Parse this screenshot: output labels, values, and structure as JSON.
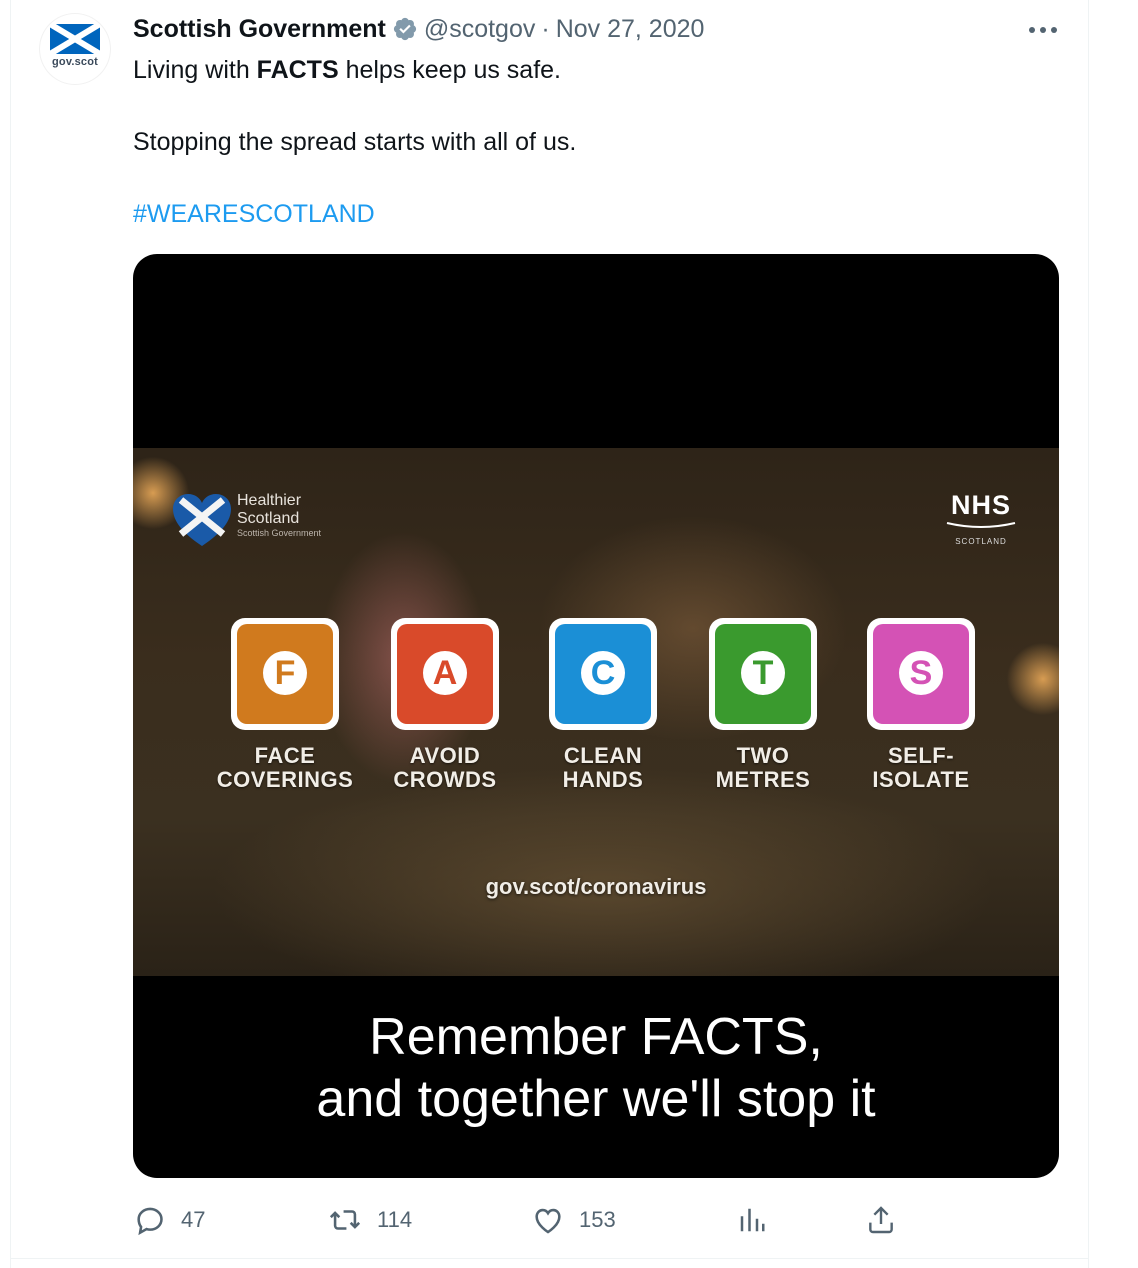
{
  "tweet": {
    "author": {
      "name": "Scottish Government",
      "handle": "@scotgov",
      "avatar_text": "gov.scot",
      "verified": true
    },
    "separator": "·",
    "date": "Nov 27, 2020",
    "text": {
      "line1_pre": "Living with ",
      "line1_bold": "FACTS",
      "line1_post": " helps keep us safe.",
      "line2": "Stopping the spread starts with all of us.",
      "hashtag": "#WEARESCOTLAND"
    },
    "media": {
      "logo_left": {
        "line1": "Healthier",
        "line2": "Scotland",
        "line3": "Scottish Government"
      },
      "logo_right": {
        "line1": "NHS",
        "line2": "SCOTLAND"
      },
      "facts": [
        {
          "letter": "F",
          "label_line1": "FACE",
          "label_line2": "COVERINGS",
          "color": "#d07a1e"
        },
        {
          "letter": "A",
          "label_line1": "AVOID",
          "label_line2": "CROWDS",
          "color": "#d94a2a"
        },
        {
          "letter": "C",
          "label_line1": "CLEAN",
          "label_line2": "HANDS",
          "color": "#1b8fd6"
        },
        {
          "letter": "T",
          "label_line1": "TWO",
          "label_line2": "METRES",
          "color": "#3a9a2e"
        },
        {
          "letter": "S",
          "label_line1": "SELF-",
          "label_line2": "ISOLATE",
          "color": "#d452b5"
        }
      ],
      "url": "gov.scot/coronavirus",
      "caption_line1": "Remember FACTS,",
      "caption_line2": "and together we'll stop it"
    },
    "actions": {
      "replies": "47",
      "retweets": "114",
      "likes": "153"
    }
  },
  "colors": {
    "link": "#1d9bf0",
    "secondary_text": "#536471",
    "verified_badge": "#829aab",
    "saltire_blue": "#0065bd"
  },
  "icons": [
    "scotland-flag-icon",
    "verified-icon",
    "more-icon",
    "reply-icon",
    "retweet-icon",
    "like-icon",
    "views-icon",
    "share-icon"
  ]
}
